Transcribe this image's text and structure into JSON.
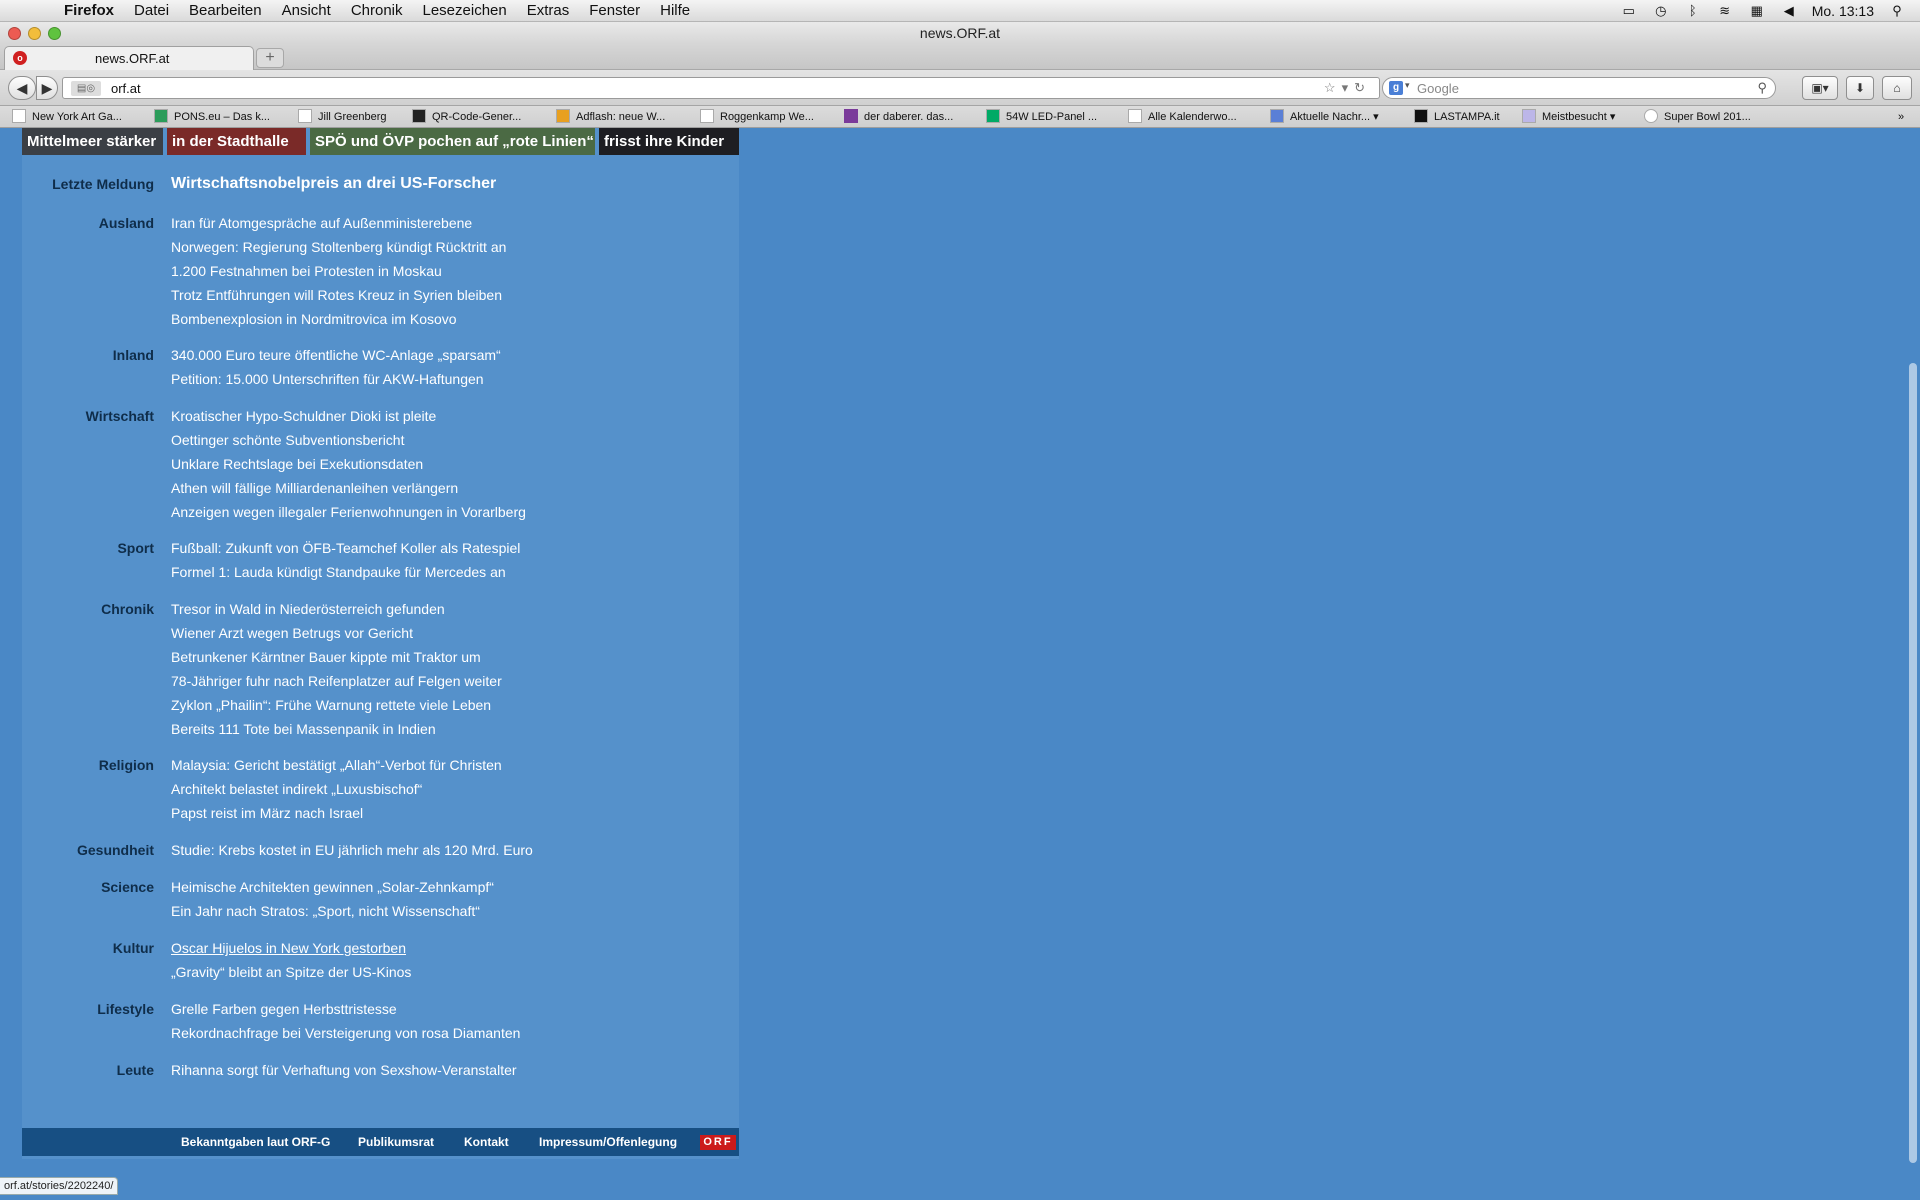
{
  "menubar": {
    "app": "Firefox",
    "items": [
      "Datei",
      "Bearbeiten",
      "Ansicht",
      "Chronik",
      "Lesezeichen",
      "Extras",
      "Fenster",
      "Hilfe"
    ],
    "clock": "Mo. 13:13"
  },
  "window": {
    "title": "news.ORF.at"
  },
  "tab": {
    "label": "news.ORF.at",
    "new_tab_label": "+"
  },
  "navbar": {
    "url": "orf.at",
    "search_placeholder": "Google"
  },
  "bookmarks": [
    "New York Art Ga...",
    "PONS.eu – Das k...",
    "Jill Greenberg",
    "QR-Code-Gener...",
    "Adflash: neue W...",
    "Roggenkamp We...",
    "der daberer. das...",
    "54W LED-Panel ...",
    "Alle Kalenderwo...",
    "Aktuelle Nachr...",
    "LASTAMPA.it",
    "Meistbesucht",
    "Super Bowl 201..."
  ],
  "banner": [
    "Mittelmeer stärker",
    "in der Stadthalle",
    "SPÖ und ÖVP pochen auf „rote Linien“",
    "frisst ihre Kinder"
  ],
  "news": {
    "latest_label": "Letzte Meldung",
    "latest_headline": "Wirtschaftsnobelpreis an drei US-Forscher",
    "sections": [
      {
        "name": "Ausland",
        "items": [
          "Iran für Atomgespräche auf Außenministerebene",
          "Norwegen: Regierung Stoltenberg kündigt Rücktritt an",
          "1.200 Festnahmen bei Protesten in Moskau",
          "Trotz Entführungen will Rotes Kreuz in Syrien bleiben",
          "Bombenexplosion in Nordmitrovica im Kosovo"
        ]
      },
      {
        "name": "Inland",
        "items": [
          "340.000 Euro teure öffentliche WC-Anlage „sparsam“",
          "Petition: 15.000 Unterschriften für AKW-Haftungen"
        ]
      },
      {
        "name": "Wirtschaft",
        "items": [
          "Kroatischer Hypo-Schuldner Dioki ist pleite",
          "Oettinger schönte Subventionsbericht",
          "Unklare Rechtslage bei Exekutionsdaten",
          "Athen will fällige Milliardenanleihen verlängern",
          "Anzeigen wegen illegaler Ferienwohnungen in Vorarlberg"
        ]
      },
      {
        "name": "Sport",
        "items": [
          "Fußball: Zukunft von ÖFB-Teamchef Koller als Ratespiel",
          "Formel 1: Lauda kündigt Standpauke für Mercedes an"
        ]
      },
      {
        "name": "Chronik",
        "items": [
          "Tresor in Wald in Niederösterreich gefunden",
          "Wiener Arzt wegen Betrugs vor Gericht",
          "Betrunkener Kärntner Bauer kippte mit Traktor um",
          "78-Jähriger fuhr nach Reifenplatzer auf Felgen weiter",
          "Zyklon „Phailin“: Frühe Warnung rettete viele Leben",
          "Bereits 111 Tote bei Massenpanik in Indien"
        ]
      },
      {
        "name": "Religion",
        "items": [
          "Malaysia: Gericht bestätigt „Allah“-Verbot für Christen",
          "Architekt belastet indirekt „Luxusbischof“",
          "Papst reist im März nach Israel"
        ]
      },
      {
        "name": "Gesundheit",
        "items": [
          "Studie: Krebs kostet in EU jährlich mehr als 120 Mrd. Euro"
        ]
      },
      {
        "name": "Science",
        "items": [
          "Heimische Architekten gewinnen „Solar-Zehnkampf“",
          "Ein Jahr nach Stratos: „Sport, nicht Wissenschaft“"
        ]
      },
      {
        "name": "Kultur",
        "items": [
          "Oscar Hijuelos in New York gestorben",
          "„Gravity“ bleibt an Spitze der US-Kinos"
        ]
      },
      {
        "name": "Lifestyle",
        "items": [
          "Grelle Farben gegen Herbsttristesse",
          "Rekordnachfrage bei Versteigerung von rosa Diamanten"
        ]
      },
      {
        "name": "Leute",
        "items": [
          "Rihanna sorgt für Verhaftung von Sexshow-Veranstalter"
        ]
      }
    ]
  },
  "footer": {
    "links": [
      "Bekanntgaben laut ORF-G",
      "Publikumsrat",
      "Kontakt",
      "Impressum/Offenlegung"
    ],
    "logo": "ORF"
  },
  "status": {
    "url": "orf.at/stories/2202240/"
  },
  "colors": {
    "page_bg": "#4a88c6",
    "content_bg": "#5591cb",
    "footer_bg": "#174f83",
    "section_label": "#0f2d4a",
    "logo_red": "#cc1b1b"
  }
}
